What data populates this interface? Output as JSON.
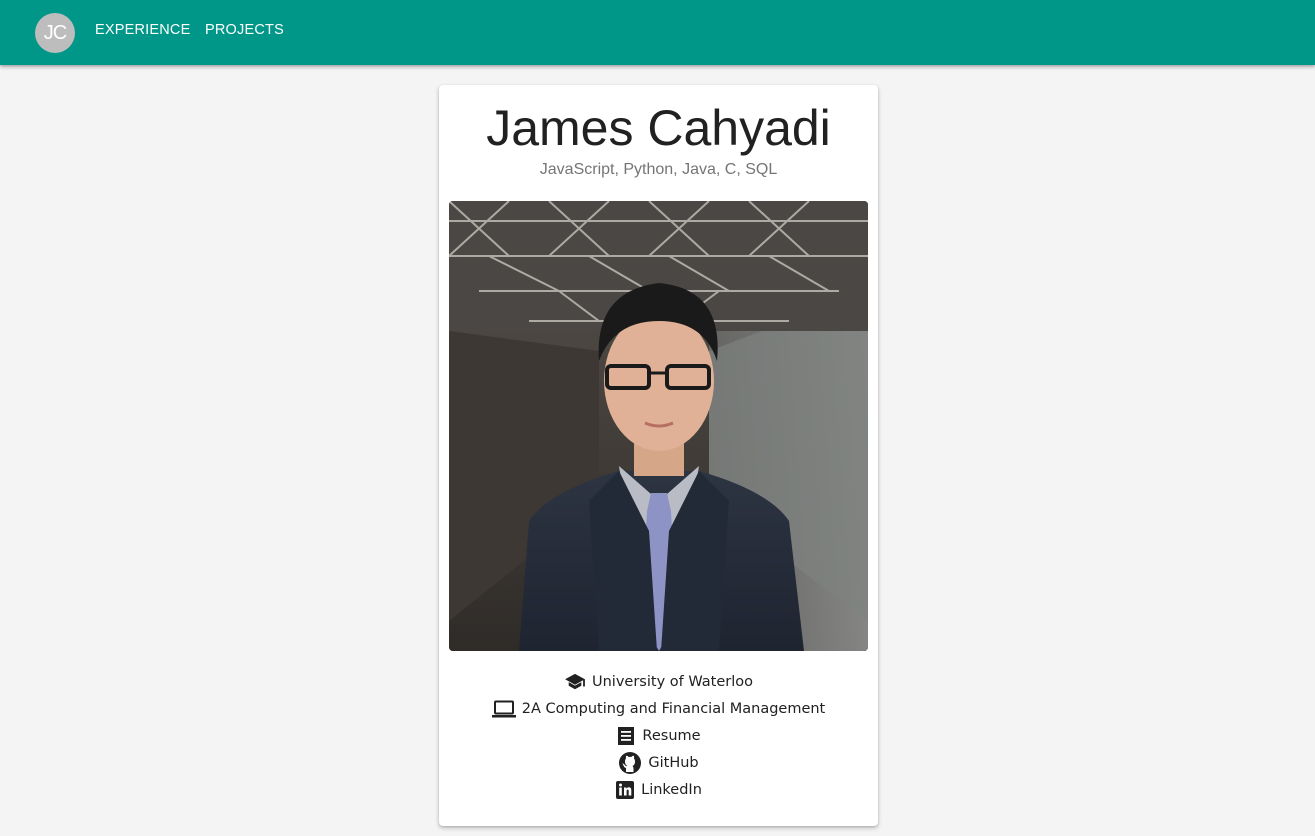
{
  "header": {
    "avatar_initials": "JC",
    "nav": [
      {
        "label": "EXPERIENCE"
      },
      {
        "label": "PROJECTS"
      }
    ],
    "color": "#009688"
  },
  "profile": {
    "name": "James Cahyadi",
    "skills": "JavaScript, Python, Java, C, SQL",
    "photo_icon": "portrait-photo",
    "details": [
      {
        "icon": "graduation-cap-icon",
        "text": "University of Waterloo"
      },
      {
        "icon": "laptop-icon",
        "text": "2A Computing and Financial Management"
      },
      {
        "icon": "receipt-icon",
        "text": "Resume"
      },
      {
        "icon": "github-icon",
        "text": "GitHub"
      },
      {
        "icon": "linkedin-icon",
        "text": "LinkedIn"
      }
    ]
  }
}
